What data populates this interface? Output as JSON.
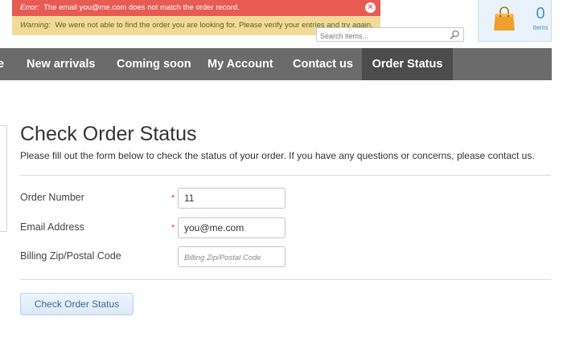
{
  "alerts": {
    "error": {
      "label": "Error:",
      "message": "The email you@me.com does not match the order record.",
      "close": "×"
    },
    "warning": {
      "label": "Warning:",
      "message": "We were not able to find the order you are looking for. Please verify your entries and try again."
    }
  },
  "search": {
    "placeholder": "Search items..."
  },
  "cart": {
    "count": "0",
    "label": "items"
  },
  "nav": {
    "items": [
      {
        "label": "e"
      },
      {
        "label": "New arrivals"
      },
      {
        "label": "Coming soon"
      },
      {
        "label": "My Account"
      },
      {
        "label": "Contact us"
      },
      {
        "label": "Order Status"
      }
    ],
    "active": "Order Status"
  },
  "page": {
    "title": "Check Order Status",
    "intro": "Please fill out the form below to check the status of your order. If you have any questions or concerns, please contact us."
  },
  "form": {
    "required_marker": "*",
    "order_number": {
      "label": "Order Number",
      "value": "11"
    },
    "email": {
      "label": "Email Address",
      "value": "you@me.com"
    },
    "zip": {
      "label": "Billing Zip/Postal Code",
      "value": "",
      "placeholder": "Billing Zip/Postal Code"
    },
    "submit_label": "Check Order Status"
  },
  "colors": {
    "error": "#e85b55",
    "warning": "#f0db9a",
    "nav": "#6b6b6b",
    "nav_active": "#4c4c4c",
    "accent": "#4a90c8"
  }
}
